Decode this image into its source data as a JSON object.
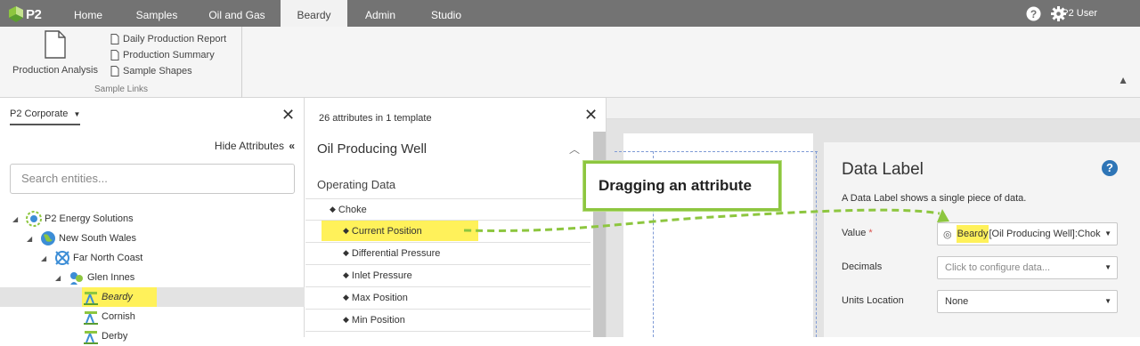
{
  "app": {
    "logo_text": "P2",
    "nav_tabs": [
      {
        "label": "Home"
      },
      {
        "label": "Samples"
      },
      {
        "label": "Oil and Gas"
      },
      {
        "label": "Beardy",
        "active": true
      },
      {
        "label": "Admin"
      },
      {
        "label": "Studio"
      }
    ],
    "user_name": "P2 User",
    "icons": {
      "help": "help-icon",
      "settings": "gear-icon"
    }
  },
  "ribbon": {
    "big_button_label": "Production Analysis",
    "links": [
      "Daily Production Report",
      "Production Summary",
      "Sample Shapes"
    ],
    "group_label": "Sample Links"
  },
  "entity_panel": {
    "scope": "P2 Corporate",
    "hide_attributes": "Hide Attributes",
    "search_placeholder": "Search entities...",
    "tree": [
      {
        "label": "P2 Energy Solutions",
        "icon": "organization-icon"
      },
      {
        "label": "New South Wales",
        "icon": "globe-icon"
      },
      {
        "label": "Far North Coast",
        "icon": "region-icon"
      },
      {
        "label": "Glen Innes",
        "icon": "people-icon"
      },
      {
        "label": "Beardy",
        "icon": "pump-jack-icon",
        "selected": true
      },
      {
        "label": "Cornish",
        "icon": "pump-jack-icon"
      },
      {
        "label": "Derby",
        "icon": "pump-jack-icon"
      }
    ]
  },
  "attribute_panel": {
    "count_text": "26 attributes in 1 template",
    "template_title": "Oil Producing Well",
    "section": "Operating Data",
    "items": [
      {
        "label": "Choke"
      },
      {
        "label": "Current Position",
        "highlighted": true
      },
      {
        "label": "Differential Pressure"
      },
      {
        "label": "Inlet Pressure"
      },
      {
        "label": "Max Position"
      },
      {
        "label": "Min Position"
      }
    ]
  },
  "properties": {
    "title": "Data Label",
    "description": "A Data Label shows a single piece of data.",
    "value_label": "Value",
    "required_marker": "*",
    "value_highlight": "Beardy",
    "value_rest": "[Oil Producing Well]:Chok",
    "decimals_label": "Decimals",
    "decimals_placeholder": "Click to configure data...",
    "units_label": "Units Location",
    "units_value": "None"
  },
  "annotation": {
    "callout_text": "Dragging an attribute"
  },
  "colors": {
    "topbar": "#737373",
    "highlight": "#fff15a",
    "callout_border": "#8dc63f",
    "help_blue": "#2e75b6"
  }
}
